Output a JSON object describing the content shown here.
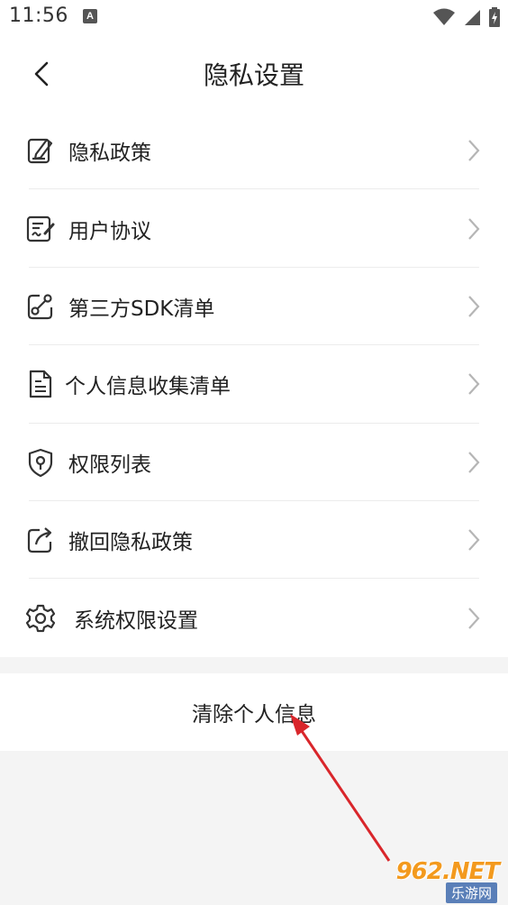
{
  "status_bar": {
    "time": "11:56",
    "notification_badge": "A"
  },
  "header": {
    "title": "隐私设置"
  },
  "menu": {
    "items": [
      {
        "label": "隐私政策",
        "icon": "edit-document-icon"
      },
      {
        "label": "用户协议",
        "icon": "signed-document-icon"
      },
      {
        "label": "第三方SDK清单",
        "icon": "share-link-icon"
      },
      {
        "label": "个人信息收集清单",
        "icon": "file-list-icon"
      },
      {
        "label": "权限列表",
        "icon": "shield-location-icon"
      },
      {
        "label": "撤回隐私政策",
        "icon": "revoke-share-icon"
      },
      {
        "label": "系统权限设置",
        "icon": "gear-icon"
      }
    ]
  },
  "clear_button": {
    "label": "清除个人信息"
  },
  "watermark": {
    "top": "962.NET",
    "bottom": "乐游网"
  },
  "colors": {
    "annotation_arrow": "#d9262b",
    "background": "#f4f4f4",
    "chevron": "#b5b5b5"
  }
}
